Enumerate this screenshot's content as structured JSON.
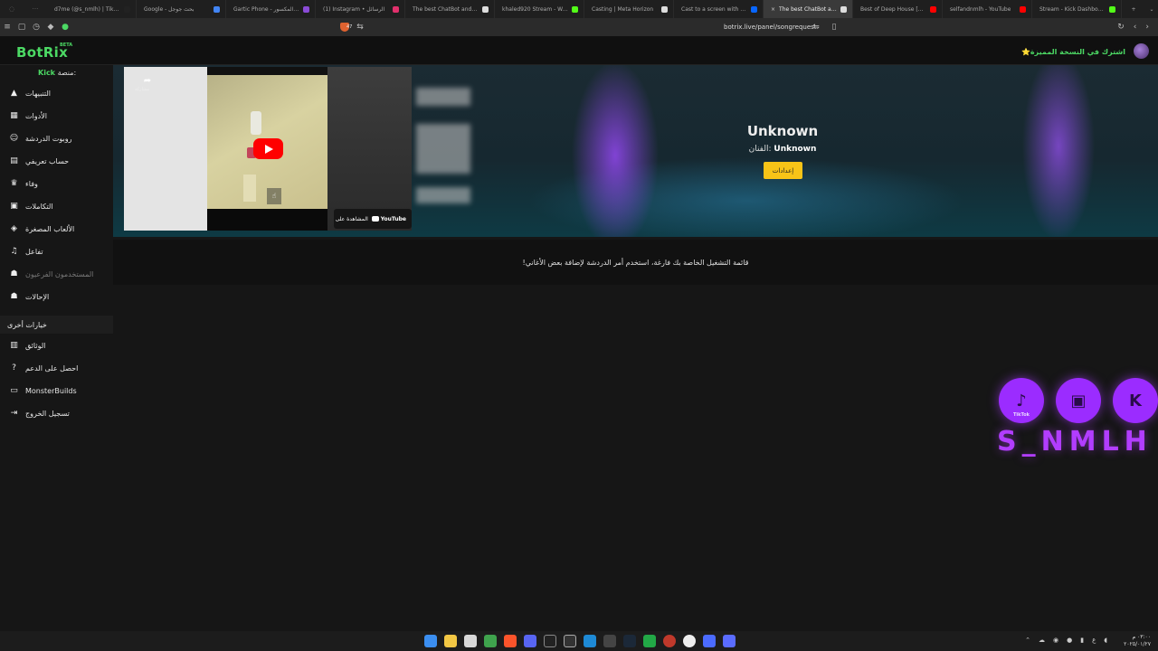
{
  "tabs": [
    {
      "title": "d7me (@s_nmlh) | TikTok(5)",
      "color": "#222222"
    },
    {
      "title": "Google - بحث جوجل",
      "color": "#4285f4"
    },
    {
      "title": "Gartic Phone - الهاتف المكسور",
      "color": "#8a4bd6"
    },
    {
      "title": "(1) Instagram • الرسائل",
      "color": "#e1306c"
    },
    {
      "title": "The best ChatBot and Wid",
      "color": "#dddddd"
    },
    {
      "title": "khaled920 Stream - Watch",
      "color": "#53fc18"
    },
    {
      "title": "Casting | Meta Horizon",
      "color": "#dddddd"
    },
    {
      "title": "Cast to a screen with Meta",
      "color": "#0866ff"
    },
    {
      "title": "The best ChatBot and Wid",
      "color": "#dddddd",
      "active": true
    },
    {
      "title": "Best of Deep House [2025]",
      "color": "#ff0000"
    },
    {
      "title": "selfandnmlh - YouTube",
      "color": "#ff0000"
    },
    {
      "title": "Stream - Kick Dashboard",
      "color": "#53fc18"
    }
  ],
  "browser": {
    "url": "botrix.live/panel/songrequest",
    "shield_count": "47"
  },
  "header": {
    "logo": "BotRix",
    "beta": "BETA",
    "premium": "اشترك في النسخة المميزة⭐"
  },
  "sidebar": {
    "platform_label": "منصة:",
    "platform_name": "Kick",
    "items": [
      {
        "label": "التنبيهات",
        "icon": "warning-icon",
        "glyph": "▲"
      },
      {
        "label": "الأدوات",
        "icon": "tools-icon",
        "glyph": "▦"
      },
      {
        "label": "روبوت الدردشة",
        "icon": "robot-icon",
        "glyph": "☺"
      },
      {
        "label": "حساب تعريفي",
        "icon": "id-card-icon",
        "glyph": "▤"
      },
      {
        "label": "وفاء",
        "icon": "trophy-icon",
        "glyph": "♛"
      },
      {
        "label": "التكاملات",
        "icon": "puzzle-icon",
        "glyph": "▣"
      },
      {
        "label": "الألعاب المصغرة",
        "icon": "gamepad-icon",
        "glyph": "◈"
      },
      {
        "label": "تفاعل",
        "icon": "music-icon",
        "glyph": "♫"
      },
      {
        "label": "المستخدمون الفرعيون",
        "icon": "users-icon",
        "glyph": "☗"
      },
      {
        "label": "الإحالات",
        "icon": "referrals-icon",
        "glyph": "☗"
      }
    ],
    "section_title": "خيارات أخرى",
    "other_items": [
      {
        "label": "الوثائق",
        "icon": "docs-icon",
        "glyph": "▥"
      },
      {
        "label": "احصل على الدعم",
        "icon": "help-icon",
        "glyph": "?"
      },
      {
        "label": "MonsterBuilds",
        "icon": "laptop-icon",
        "glyph": "▭"
      },
      {
        "label": "تسجيل الخروج",
        "icon": "logout-icon",
        "glyph": "⇥"
      }
    ]
  },
  "player": {
    "share_label": "مشاركة",
    "watch_on": "المشاهدة على",
    "youtube": "YouTube",
    "song_title": "Unknown",
    "artist_label": "الفنان:",
    "artist_name": "Unknown",
    "settings_button": "إعدادات"
  },
  "queue": {
    "empty_message": "قائمة التشغيل الخاصة بك فارغة، استخدم أمر الدردشة لإضافة بعض الأغاني!"
  },
  "overlay": {
    "name": "S_NMLH",
    "tiktok_label": "TikTok",
    "icons": [
      "tiktok-icon",
      "twitch-icon",
      "kick-icon"
    ],
    "color": "#9b2cff"
  },
  "taskbar": {
    "time": "٠٣:٠٠ م",
    "date": "٢٠٢٥/٠١/٢٧"
  }
}
